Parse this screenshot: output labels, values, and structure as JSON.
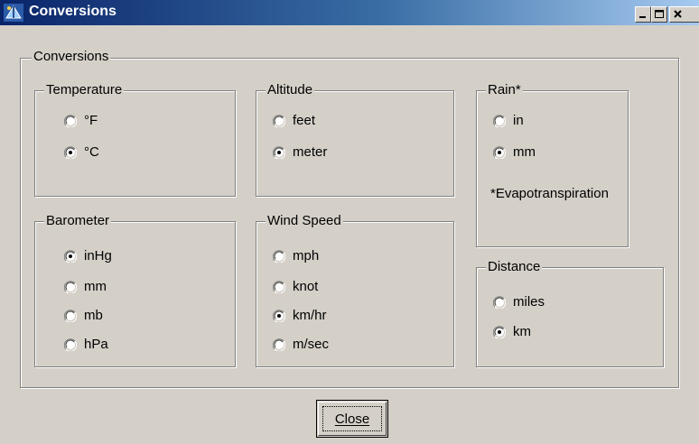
{
  "window": {
    "title": "Conversions",
    "icon": "weather-app-icon",
    "controls": [
      "minimize-icon",
      "maximize-icon",
      "close-icon"
    ]
  },
  "main_group": {
    "label": "Conversions"
  },
  "temperature": {
    "label": "Temperature",
    "options": [
      {
        "label": "°F",
        "selected": false
      },
      {
        "label": "°C",
        "selected": true
      }
    ]
  },
  "altitude": {
    "label": "Altitude",
    "options": [
      {
        "label": "feet",
        "selected": false
      },
      {
        "label": "meter",
        "selected": true
      }
    ]
  },
  "rain": {
    "label": "Rain*",
    "options": [
      {
        "label": "in",
        "selected": false
      },
      {
        "label": "mm",
        "selected": true
      }
    ],
    "note": "*Evapotranspiration"
  },
  "barometer": {
    "label": "Barometer",
    "options": [
      {
        "label": "inHg",
        "selected": true
      },
      {
        "label": "mm",
        "selected": false
      },
      {
        "label": "mb",
        "selected": false
      },
      {
        "label": "hPa",
        "selected": false
      }
    ]
  },
  "wind_speed": {
    "label": "Wind Speed",
    "options": [
      {
        "label": "mph",
        "selected": false
      },
      {
        "label": "knot",
        "selected": false
      },
      {
        "label": "km/hr",
        "selected": true
      },
      {
        "label": "m/sec",
        "selected": false
      }
    ]
  },
  "distance": {
    "label": "Distance",
    "options": [
      {
        "label": "miles",
        "selected": false
      },
      {
        "label": "km",
        "selected": true
      }
    ]
  },
  "buttons": {
    "close_label": "Close"
  }
}
